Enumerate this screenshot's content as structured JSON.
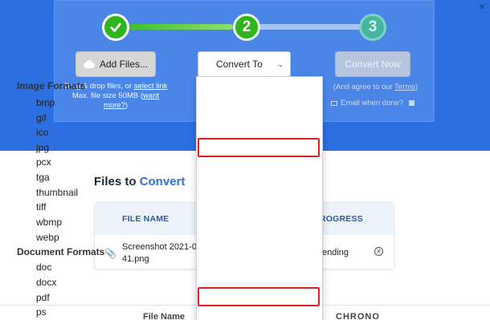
{
  "steps": [
    "",
    "2",
    "3"
  ],
  "add_files": {
    "label": "Add Files..."
  },
  "drag_text": {
    "line1": "Drag & drop files, or ",
    "link": "select link",
    "line2": "Max. file size 50MB (",
    "want_more": "want more?",
    "close_paren": ")"
  },
  "convert_to": {
    "label": "Convert To",
    "chevron": "⌄"
  },
  "convert_now": {
    "label": "Convert Now"
  },
  "agree": {
    "prefix": "(And agree to our ",
    "terms": "Terms",
    "suffix": ")"
  },
  "email": {
    "label": "Email when done?"
  },
  "files_section": {
    "title_prefix": "Files to ",
    "title_accent": "Convert"
  },
  "table": {
    "headers": {
      "file_name": "FILE NAME",
      "progress": "ROGRESS"
    },
    "row": {
      "name_line1": "Screenshot 2021-0",
      "name_line2": "41.png",
      "status": "ending"
    }
  },
  "footer_fragments": [
    "File Name",
    "CHRONO"
  ],
  "dropdown": {
    "groups": [
      {
        "label": "Image Formats",
        "items": [
          "bmp",
          "gif",
          "ico",
          "jpg",
          "pcx",
          "tga",
          "thumbnail",
          "tiff",
          "wbmp",
          "webp"
        ]
      },
      {
        "label": "Document Formats",
        "items": [
          "doc",
          "docx",
          "pdf",
          "ps"
        ]
      }
    ],
    "highlighted": [
      "jpg",
      "pdf"
    ]
  },
  "colors": {
    "hero": "#2c6fe0",
    "panel": "#4a86e8",
    "step_done": "#2eb41c",
    "highlight": "#e0201e",
    "accent": "#2c6fe0"
  }
}
